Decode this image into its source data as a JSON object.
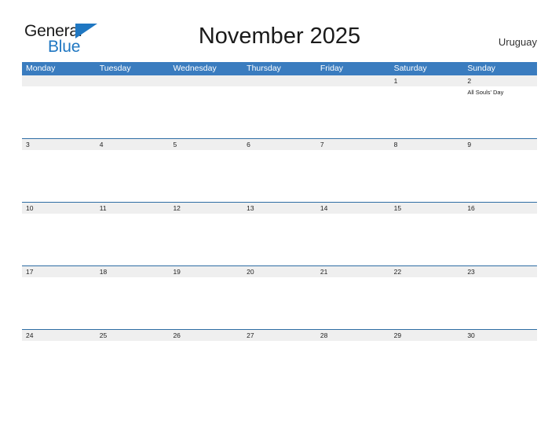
{
  "brand": {
    "name_part1": "General",
    "name_part2": "Blue",
    "flag_icon": "blue-triangle-flag"
  },
  "header": {
    "title": "November 2025",
    "country": "Uruguay"
  },
  "calendar": {
    "weekday_headers": [
      "Monday",
      "Tuesday",
      "Wednesday",
      "Thursday",
      "Friday",
      "Saturday",
      "Sunday"
    ],
    "weeks": [
      {
        "days": [
          {
            "date": "",
            "events": []
          },
          {
            "date": "",
            "events": []
          },
          {
            "date": "",
            "events": []
          },
          {
            "date": "",
            "events": []
          },
          {
            "date": "",
            "events": []
          },
          {
            "date": "1",
            "events": []
          },
          {
            "date": "2",
            "events": [
              "All Souls' Day"
            ]
          }
        ]
      },
      {
        "days": [
          {
            "date": "3",
            "events": []
          },
          {
            "date": "4",
            "events": []
          },
          {
            "date": "5",
            "events": []
          },
          {
            "date": "6",
            "events": []
          },
          {
            "date": "7",
            "events": []
          },
          {
            "date": "8",
            "events": []
          },
          {
            "date": "9",
            "events": []
          }
        ]
      },
      {
        "days": [
          {
            "date": "10",
            "events": []
          },
          {
            "date": "11",
            "events": []
          },
          {
            "date": "12",
            "events": []
          },
          {
            "date": "13",
            "events": []
          },
          {
            "date": "14",
            "events": []
          },
          {
            "date": "15",
            "events": []
          },
          {
            "date": "16",
            "events": []
          }
        ]
      },
      {
        "days": [
          {
            "date": "17",
            "events": []
          },
          {
            "date": "18",
            "events": []
          },
          {
            "date": "19",
            "events": []
          },
          {
            "date": "20",
            "events": []
          },
          {
            "date": "21",
            "events": []
          },
          {
            "date": "22",
            "events": []
          },
          {
            "date": "23",
            "events": []
          }
        ]
      },
      {
        "days": [
          {
            "date": "24",
            "events": []
          },
          {
            "date": "25",
            "events": []
          },
          {
            "date": "26",
            "events": []
          },
          {
            "date": "27",
            "events": []
          },
          {
            "date": "28",
            "events": []
          },
          {
            "date": "29",
            "events": []
          },
          {
            "date": "30",
            "events": []
          }
        ]
      }
    ]
  },
  "colors": {
    "header_blue": "#3a7cbf",
    "week_rule_blue": "#2e6da4",
    "date_band_gray": "#efefef",
    "brand_blue": "#1f77c2",
    "text_dark": "#1a1a1a"
  }
}
